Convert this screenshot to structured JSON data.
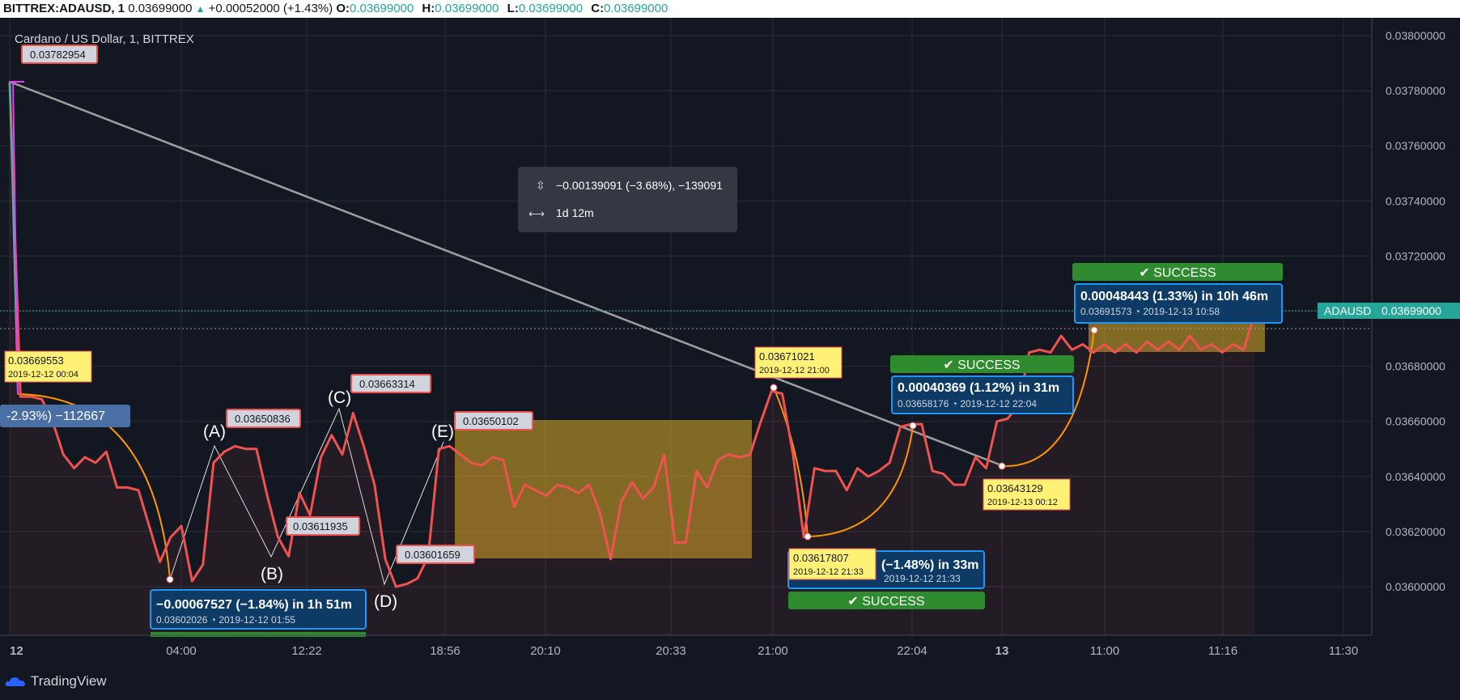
{
  "header": {
    "symbol": "BITTREX:ADAUSD, 1",
    "last": "0.03699000",
    "change": "+0.00052000 (+1.43%)",
    "o_label": "O:",
    "o_value": "0.03699000",
    "h_label": "H:",
    "h_value": "0.03699000",
    "l_label": "L:",
    "l_value": "0.03699000",
    "c_label": "C:",
    "c_value": "0.03699000"
  },
  "footer": {
    "brand": "TradingView"
  },
  "colors": {
    "price_line": "#ef5350",
    "background": "#131722",
    "success": "#2e8b2e",
    "yellow_box": "#fff176",
    "blue_box": "#0d3b66",
    "pattern_fill": "#c9a227",
    "trend_line": "#9e9e9e",
    "arc": "#ff9800",
    "current_price": "#26a69a"
  },
  "chart_data": {
    "type": "line",
    "title": "Cardano / US Dollar, 1, BITTREX",
    "y_ticks": [
      "0.03800000",
      "0.03780000",
      "0.03760000",
      "0.03740000",
      "0.03720000",
      "0.03700000",
      "0.03680000",
      "0.03660000",
      "0.03640000",
      "0.03620000",
      "0.03600000"
    ],
    "x_ticks": [
      "12",
      "04:00",
      "12:22",
      "18:56",
      "20:10",
      "20:33",
      "21:00",
      "22:04",
      "13",
      "11:00",
      "11:16",
      "11:30"
    ],
    "ylim": [
      0.0359,
      0.03802
    ],
    "series": [
      {
        "values": [
          0.03783,
          0.03669,
          0.03669,
          0.03668,
          0.0366,
          0.03648,
          0.03643,
          0.03647,
          0.03645,
          0.03649,
          0.03636,
          0.03636,
          0.03635,
          0.03622,
          0.03609,
          0.03618,
          0.03622,
          0.03602,
          0.03608,
          0.03645,
          0.03649,
          0.03651,
          0.0365,
          0.0365,
          0.03633,
          0.03618,
          0.03611,
          0.03634,
          0.03626,
          0.03647,
          0.03655,
          0.03648,
          0.03663,
          0.03651,
          0.03637,
          0.0361,
          0.036,
          0.03601,
          0.03603,
          0.03611,
          0.0365,
          0.03651,
          0.03648,
          0.03645,
          0.03644,
          0.03647,
          0.03646,
          0.03629,
          0.03637,
          0.03635,
          0.03633,
          0.03637,
          0.03636,
          0.03634,
          0.03637,
          0.03627,
          0.0361,
          0.03631,
          0.03638,
          0.03632,
          0.03636,
          0.03648,
          0.03616,
          0.03616,
          0.03642,
          0.03636,
          0.03646,
          0.03648,
          0.03647,
          0.03648,
          0.0366,
          0.03671,
          0.0367,
          0.03648,
          0.03618,
          0.03643,
          0.03642,
          0.03642,
          0.03635,
          0.03643,
          0.0364,
          0.03642,
          0.03645,
          0.03658,
          0.03659,
          0.03659,
          0.03642,
          0.03641,
          0.03637,
          0.03637,
          0.03647,
          0.03643,
          0.0366,
          0.03661,
          0.03666,
          0.03685,
          0.03686,
          0.03685,
          0.03691,
          0.03686,
          0.03688,
          0.03685,
          0.03688,
          0.03685,
          0.03688,
          0.03685,
          0.03689,
          0.03686,
          0.03689,
          0.03686,
          0.03691,
          0.03686,
          0.03688,
          0.03685,
          0.03688,
          0.03686,
          0.03699
        ]
      }
    ],
    "current_price": {
      "symbol": "ADAUSD",
      "value": "0.03699000"
    },
    "labels": {
      "high": "0.03782954",
      "yellow1_price": "0.03669553",
      "yellow1_time": "2019-12-12 00:04",
      "left_partial": "-2.93%) −112667",
      "A_price": "0.03650836",
      "B_price": "0.03611935",
      "C_price": "0.03663314",
      "D_price": "0.03601659",
      "E_price": "0.03650102",
      "A": "(A)",
      "B": "(B)",
      "C": "(C)",
      "D": "(D)",
      "E": "(E)",
      "blue1_main": "−0.00067527 (−1.84%) in 1h 51m",
      "blue1_sub": "0.03602026 ◔  2019-12-12  01:55",
      "yellow2_price": "0.03671021",
      "yellow2_time": "2019-12-12 21:00",
      "yellow3_price": "0.03617807",
      "yellow3_time": "2019-12-12 21:33",
      "blue2_main": "(−1.48%) in 33m",
      "blue2_sub": "2019-12-12  21:33",
      "success": "✔ SUCCESS",
      "blue3_main": "0.00040369 (1.12%) in 31m",
      "blue3_sub": "0.03658176 ◔  2019-12-12  22:04",
      "yellow4_price": "0.03643129",
      "yellow4_time": "2019-12-13 00:12",
      "blue4_main": "0.00048443 (1.33%) in 10h 46m",
      "blue4_sub": "0.03691573 ◔  2019-12-13  10:58",
      "measure_price": "−0.00139091 (−3.68%), −139091",
      "measure_time": "1d 12m"
    }
  }
}
